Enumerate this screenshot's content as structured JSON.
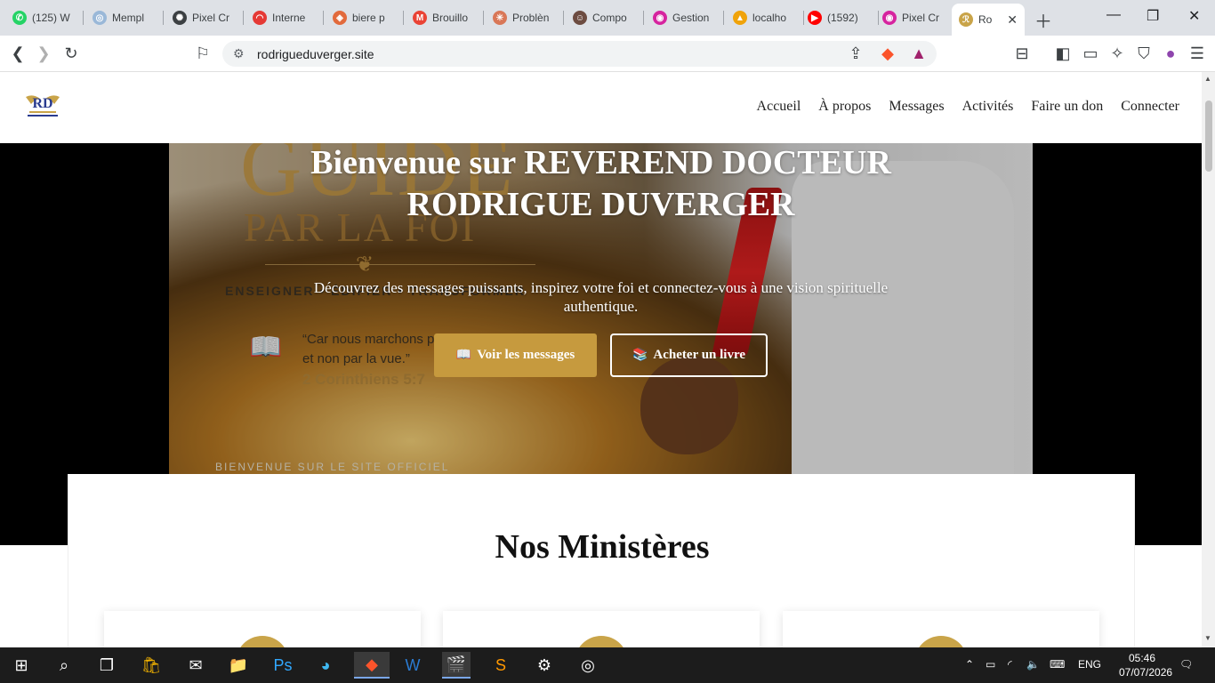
{
  "browser": {
    "tabs": [
      {
        "title": "(125) W",
        "fav_color": "#25d366",
        "fav_glyph": "✆",
        "icon": "whatsapp-icon"
      },
      {
        "title": "Mempl",
        "fav_color": "#9ab8d8",
        "fav_glyph": "◎",
        "icon": "memplus-icon"
      },
      {
        "title": "Pixel Cr",
        "fav_color": "#3c4043",
        "fav_glyph": "✺",
        "icon": "openai-icon"
      },
      {
        "title": "Interne",
        "fav_color": "#e53935",
        "fav_glyph": "◠",
        "icon": "speedtest-icon"
      },
      {
        "title": "biere p",
        "fav_color": "#e26a3c",
        "fav_glyph": "◈",
        "icon": "brave-search-icon"
      },
      {
        "title": "Brouillo",
        "fav_color": "#ea4335",
        "fav_glyph": "M",
        "icon": "gmail-icon"
      },
      {
        "title": "Problèn",
        "fav_color": "#d97757",
        "fav_glyph": "✳",
        "icon": "claude-icon"
      },
      {
        "title": "Compo",
        "fav_color": "#6d4c41",
        "fav_glyph": "☺",
        "icon": "composer-icon"
      },
      {
        "title": "Gestion",
        "fav_color": "#d6249f",
        "fav_glyph": "◉",
        "icon": "gestion-icon"
      },
      {
        "title": "localho",
        "fav_color": "#f0a30a",
        "fav_glyph": "▲",
        "icon": "phpmyadmin-icon"
      },
      {
        "title": "(1592)",
        "fav_color": "#ff0000",
        "fav_glyph": "▶",
        "icon": "youtube-icon"
      },
      {
        "title": "Pixel Cr",
        "fav_color": "#d6249f",
        "fav_glyph": "◉",
        "icon": "pixelcr-icon"
      },
      {
        "title": "Ro",
        "fav_color": "#c9a449",
        "fav_glyph": "ℛ",
        "icon": "site-favicon-icon"
      }
    ],
    "url": "rodrigueduverger.site"
  },
  "site": {
    "nav": [
      "Accueil",
      "À propos",
      "Messages",
      "Activités",
      "Faire un don",
      "Connecter"
    ],
    "hero": {
      "title": "Bienvenue sur REVEREND DOCTEUR RODRIGUE DUVERGER",
      "subtitle": "Découvrez des messages puissants, inspirez votre foi et connectez-vous à une vision spirituelle authentique.",
      "btn_messages": "Voir les messages",
      "btn_book": "Acheter un livre",
      "image_text": {
        "guide": "GUIDÉ",
        "parlafoi": "PAR LA FOI",
        "tagline": "ENSEIGNER • ÉDIFIER • TRANSFORMER",
        "verse_line1": "“Car nous marchons par la foi",
        "verse_line2": "et non par la vue.”",
        "reference": "2 Corinthiens 5:7",
        "footer": "BIENVENUE SUR LE SITE OFFICIEL"
      }
    },
    "ministries_title": "Nos Ministères",
    "accent_color": "#c69a3e"
  },
  "taskbar": {
    "language": "ENG",
    "time": "05:46",
    "date": "07/07/2026"
  }
}
